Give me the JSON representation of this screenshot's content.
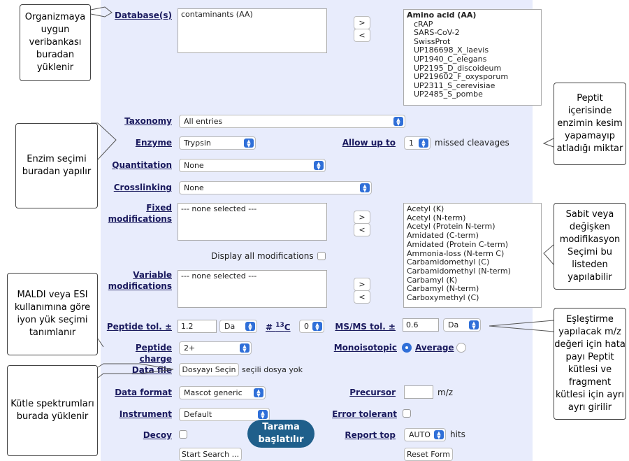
{
  "form": {
    "database": {
      "label": "Database(s)",
      "selected": [
        "contaminants (AA)"
      ],
      "available": [
        "Amino acid (AA)",
        "cRAP",
        "SARS-CoV-2",
        "SwissProt",
        "UP186698_X_laevis",
        "UP1940_C_elegans",
        "UP2195_D_discoideum",
        "UP219602_F_oxysporum",
        "UP2311_S_cerevisiae",
        "UP2485_S_pombe"
      ]
    },
    "add_label": ">",
    "remove_label": "<",
    "taxonomy": {
      "label": "Taxonomy",
      "value": "All entries"
    },
    "enzyme": {
      "label": "Enzyme",
      "value": "Trypsin"
    },
    "allow_up_to": {
      "label": "Allow up to",
      "value": "1",
      "suffix": "missed cleavages"
    },
    "quantitation": {
      "label": "Quantitation",
      "value": "None"
    },
    "crosslinking": {
      "label": "Crosslinking",
      "value": "None"
    },
    "fixed_mods": {
      "label_line1": "Fixed",
      "label_line2": "modifications",
      "value": "--- none selected ---"
    },
    "display_all": "Display all modifications",
    "mods_list": [
      "Acetyl (K)",
      "Acetyl (N-term)",
      "Acetyl (Protein N-term)",
      "Amidated (C-term)",
      "Amidated (Protein C-term)",
      "Ammonia-loss (N-term C)",
      "Carbamidomethyl (C)",
      "Carbamidomethyl (N-term)",
      "Carbamyl (K)",
      "Carbamyl (N-term)",
      "Carboxymethyl (C)"
    ],
    "variable_mods": {
      "label_line1": "Variable",
      "label_line2": "modifications",
      "value": "--- none selected ---"
    },
    "peptide_tol": {
      "label": "Peptide tol. ±",
      "value": "1.2",
      "unit": "Da"
    },
    "c13": {
      "label_pre": "# ",
      "label_sup": "13",
      "label_post": "C",
      "value": "0"
    },
    "msms_tol": {
      "label": "MS/MS tol. ±",
      "value": "0.6",
      "unit": "Da"
    },
    "peptide_charge": {
      "label": "Peptide charge",
      "value": "2+"
    },
    "monoisotopic": {
      "label": "Monoisotopic",
      "average": "Average"
    },
    "data_file": {
      "label": "Data file",
      "button": "Dosyayı Seçin",
      "status": "seçili dosya yok"
    },
    "data_format": {
      "label": "Data format",
      "value": "Mascot generic"
    },
    "precursor": {
      "label": "Precursor",
      "value": "",
      "unit": "m/z"
    },
    "instrument": {
      "label": "Instrument",
      "value": "Default"
    },
    "error_tolerant": {
      "label": "Error tolerant"
    },
    "decoy": {
      "label": "Decoy"
    },
    "report_top": {
      "label": "Report top",
      "value": "AUTO",
      "suffix": "hits"
    },
    "start_search": "Start Search ...",
    "reset_form": "Reset Form"
  },
  "callouts": {
    "database": "Organizmaya uygun veribankası buradan yüklenir",
    "enzyme": "Enzim seçimi buradan yapılır",
    "ionload": "MALDI veya ESI kullanımına göre iyon yük seçimi tanımlanır",
    "spectra": "Kütle spektrumları burada yüklenir",
    "missed": "Peptit içerisinde enzimin kesim yapamayıp atladığı miktar",
    "modifications": "Sabit veya değişken modifikasyon Seçimi bu listeden yapılabilir",
    "tolerance": "Eşleştirme yapılacak m/z değeri için hata payı Peptit kütlesi ve fragment kütlesi için ayrı ayrı girilir",
    "search": "Tarama başlatılır"
  },
  "colors": {
    "form_bg": "#e8ecfc",
    "label": "#1a1a5e",
    "accent": "#2f6fd8",
    "pill": "#1f5f8b"
  }
}
